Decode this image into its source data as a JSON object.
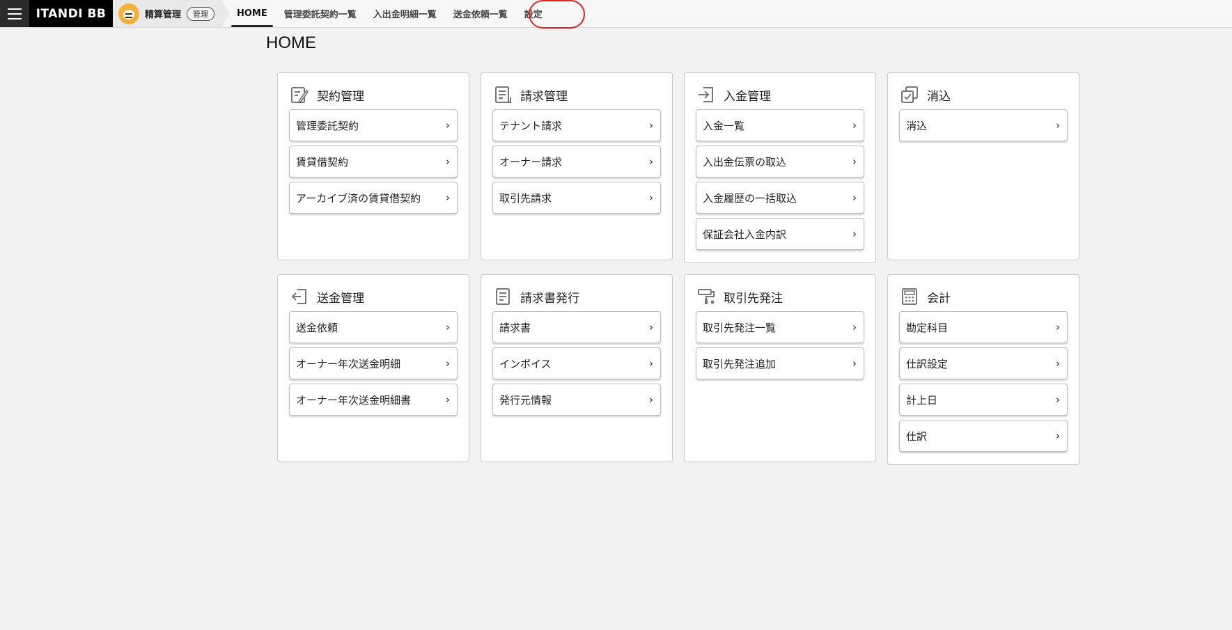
{
  "header": {
    "logo": "ITANDI BB",
    "product_name": "精算管理",
    "product_badge": "管理",
    "nav": [
      {
        "label": "HOME",
        "active": true
      },
      {
        "label": "管理委託契約一覧",
        "active": false
      },
      {
        "label": "入出金明細一覧",
        "active": false
      },
      {
        "label": "送金依頼一覧",
        "active": false
      },
      {
        "label": "設定",
        "active": false
      }
    ],
    "highlight_color": "#e8231f"
  },
  "page": {
    "title": "HOME"
  },
  "cards": [
    {
      "title": "契約管理",
      "icon": "contract-edit-icon",
      "links": [
        "管理委託契約",
        "賃貸借契約",
        "アーカイブ済の賃貸借契約"
      ]
    },
    {
      "title": "請求管理",
      "icon": "invoice-document-icon",
      "links": [
        "テナント請求",
        "オーナー請求",
        "取引先請求"
      ]
    },
    {
      "title": "入金管理",
      "icon": "deposit-import-icon",
      "links": [
        "入金一覧",
        "入出金伝票の取込",
        "入金履歴の一括取込",
        "保証会社入金内訳"
      ]
    },
    {
      "title": "消込",
      "icon": "reconcile-check-icon",
      "links": [
        "消込"
      ]
    },
    {
      "title": "送金管理",
      "icon": "remittance-export-icon",
      "links": [
        "送金依頼",
        "オーナー年次送金明細",
        "オーナー年次送金明細書"
      ]
    },
    {
      "title": "請求書発行",
      "icon": "document-icon",
      "links": [
        "請求書",
        "インボイス",
        "発行元情報"
      ]
    },
    {
      "title": "取引先発注",
      "icon": "paint-roller-icon",
      "links": [
        "取引先発注一覧",
        "取引先発注追加"
      ]
    },
    {
      "title": "会計",
      "icon": "calculator-icon",
      "links": [
        "勘定科目",
        "仕訳設定",
        "計上日",
        "仕訳"
      ]
    }
  ],
  "chevron": "›"
}
